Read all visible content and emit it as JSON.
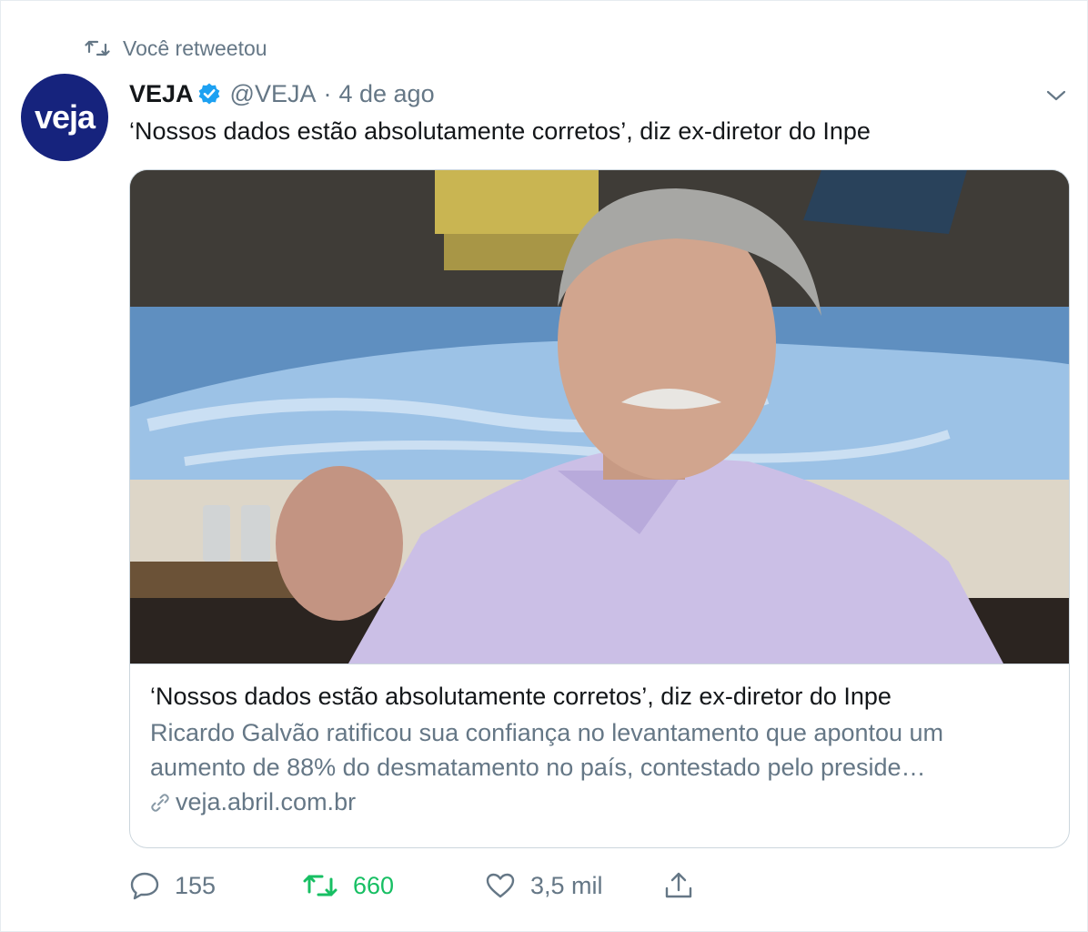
{
  "retweet_context": {
    "text": "Você retweetou",
    "icon": "retweet-icon"
  },
  "author": {
    "avatar_text": "veja",
    "name": "VEJA",
    "handle": "@VEJA",
    "separator": "·",
    "time": "4 de ago",
    "verified": true
  },
  "tweet": {
    "text": "‘Nossos dados estão absolutamente corretos’, diz ex-diretor do Inpe"
  },
  "card": {
    "image_alt": "photo",
    "title": "‘Nossos dados estão absolutamente corretos’, diz ex-diretor do Inpe",
    "description_line1": "Ricardo Galvão ratificou sua confiança no levantamento que apontou um",
    "description_line2": "aumento de 88% do desmatamento no país, contestado pelo preside…",
    "url": "veja.abril.com.br"
  },
  "actions": {
    "reply_count": "155",
    "retweet_count": "660",
    "like_count": "3,5 mil"
  },
  "colors": {
    "accent": "#1da1f2",
    "retweet_active": "#17bf63",
    "muted": "#657786",
    "avatar_bg": "#16237d"
  }
}
